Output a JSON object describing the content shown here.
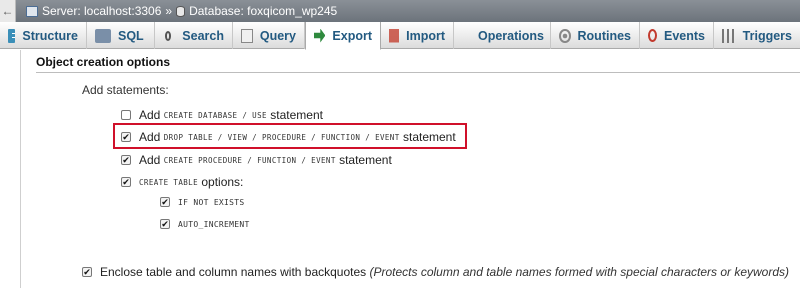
{
  "breadcrumb": {
    "server_label": "Server: localhost:3306",
    "separator": "»",
    "database_label": "Database: foxqicom_wp245"
  },
  "tabs": [
    {
      "label": "Structure",
      "icon": "structure-icon"
    },
    {
      "label": "SQL",
      "icon": "sql-icon"
    },
    {
      "label": "Search",
      "icon": "search-icon"
    },
    {
      "label": "Query",
      "icon": "query-icon"
    },
    {
      "label": "Export",
      "icon": "export-icon",
      "active": true
    },
    {
      "label": "Import",
      "icon": "import-icon"
    },
    {
      "label": "Operations",
      "icon": "operations-icon"
    },
    {
      "label": "Routines",
      "icon": "routines-icon"
    },
    {
      "label": "Events",
      "icon": "events-icon"
    },
    {
      "label": "Triggers",
      "icon": "triggers-icon"
    }
  ],
  "section": {
    "title": "Object creation options",
    "add_statements_label": "Add statements:"
  },
  "options": {
    "create_database": {
      "prefix": "Add",
      "code": "CREATE DATABASE / USE",
      "suffix": "statement",
      "checked": false
    },
    "drop_table": {
      "prefix": "Add",
      "code": "DROP TABLE / VIEW / PROCEDURE / FUNCTION / EVENT",
      "suffix": "statement",
      "checked": true
    },
    "create_procedure": {
      "prefix": "Add",
      "code": "CREATE PROCEDURE / FUNCTION / EVENT",
      "suffix": "statement",
      "checked": true
    },
    "create_table": {
      "code": "CREATE TABLE",
      "suffix": "options:",
      "checked": true
    },
    "if_not_exists": {
      "code": "IF NOT EXISTS",
      "checked": true
    },
    "auto_increment": {
      "code": "AUTO_INCREMENT",
      "checked": true
    },
    "backquotes": {
      "text": "Enclose table and column names with backquotes",
      "note": "(Protects column and table names formed with special characters or keywords)",
      "checked": true
    }
  },
  "colors": {
    "highlight": "#d0102a",
    "tab_text": "#235a81"
  }
}
